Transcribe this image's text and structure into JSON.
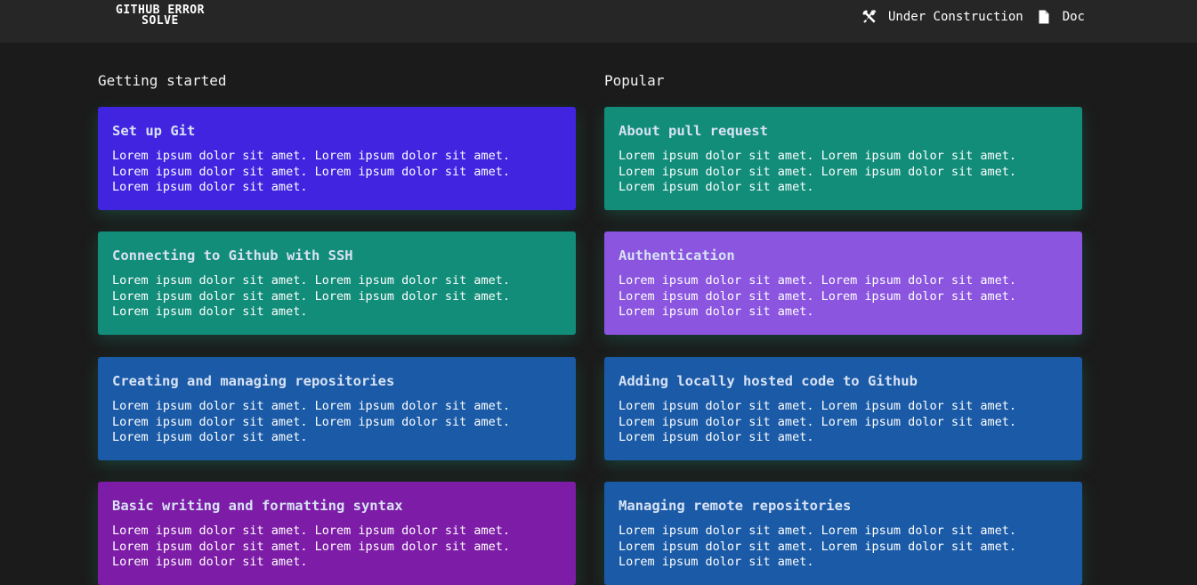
{
  "nav": {
    "brand_line1": "GITHUB ERROR",
    "brand_line2": "SOLVE",
    "links": [
      {
        "label": "Under Construction",
        "icon": "tools-icon"
      },
      {
        "label": "Doc",
        "icon": "document-icon"
      }
    ]
  },
  "sections": {
    "left_heading": "Getting started",
    "right_heading": "Popular"
  },
  "cards": {
    "left": [
      {
        "title": "Set up Git",
        "description": "Lorem ipsum dolor sit amet. Lorem ipsum dolor sit amet.\nLorem ipsum dolor sit amet. Lorem ipsum dolor sit amet.\nLorem ipsum dolor sit amet.",
        "color": "#4124e0"
      },
      {
        "title": "Connecting to Github with SSH",
        "description": "Lorem ipsum dolor sit amet. Lorem ipsum dolor sit amet.\nLorem ipsum dolor sit amet. Lorem ipsum dolor sit amet.\nLorem ipsum dolor sit amet.",
        "color": "#118d7a"
      },
      {
        "title": "Creating and managing repositories",
        "description": "Lorem ipsum dolor sit amet. Lorem ipsum dolor sit amet.\nLorem ipsum dolor sit amet. Lorem ipsum dolor sit amet.\nLorem ipsum dolor sit amet.",
        "color": "#1a5aa6"
      },
      {
        "title": "Basic writing and formatting syntax",
        "description": "Lorem ipsum dolor sit amet. Lorem ipsum dolor sit amet.\nLorem ipsum dolor sit amet. Lorem ipsum dolor sit amet.\nLorem ipsum dolor sit amet.",
        "color": "#7d1ca6"
      }
    ],
    "right": [
      {
        "title": "About pull request",
        "description": "Lorem ipsum dolor sit amet. Lorem ipsum dolor sit amet.\nLorem ipsum dolor sit amet. Lorem ipsum dolor sit amet.\nLorem ipsum dolor sit amet.",
        "color": "#118d7a"
      },
      {
        "title": "Authentication",
        "description": "Lorem ipsum dolor sit amet. Lorem ipsum dolor sit amet.\nLorem ipsum dolor sit amet. Lorem ipsum dolor sit amet.\nLorem ipsum dolor sit amet.",
        "color": "#8b55e0"
      },
      {
        "title": "Adding locally hosted code to Github",
        "description": "Lorem ipsum dolor sit amet. Lorem ipsum dolor sit amet.\nLorem ipsum dolor sit amet. Lorem ipsum dolor sit amet.\nLorem ipsum dolor sit amet.",
        "color": "#1a5aa6"
      },
      {
        "title": "Managing remote repositories",
        "description": "Lorem ipsum dolor sit amet. Lorem ipsum dolor sit amet.\nLorem ipsum dolor sit amet. Lorem ipsum dolor sit amet.\nLorem ipsum dolor sit amet.",
        "color": "#1a5aa6"
      }
    ]
  }
}
